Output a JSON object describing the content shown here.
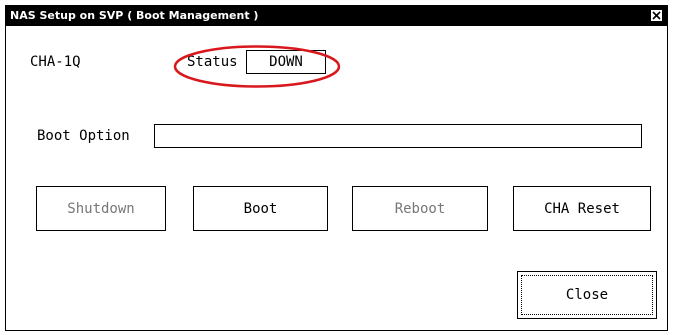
{
  "window": {
    "title": "NAS Setup on SVP ( Boot Management )",
    "close_glyph": "close-icon"
  },
  "channel": {
    "name": "CHA-1Q",
    "status_label": "Status",
    "status_value": "DOWN",
    "highlight_color": "#d9181d"
  },
  "boot_option": {
    "label": "Boot Option",
    "value": ""
  },
  "actions": {
    "shutdown": "Shutdown",
    "boot": "Boot",
    "reboot": "Reboot",
    "cha_reset": "CHA Reset"
  },
  "footer": {
    "close": "Close"
  }
}
